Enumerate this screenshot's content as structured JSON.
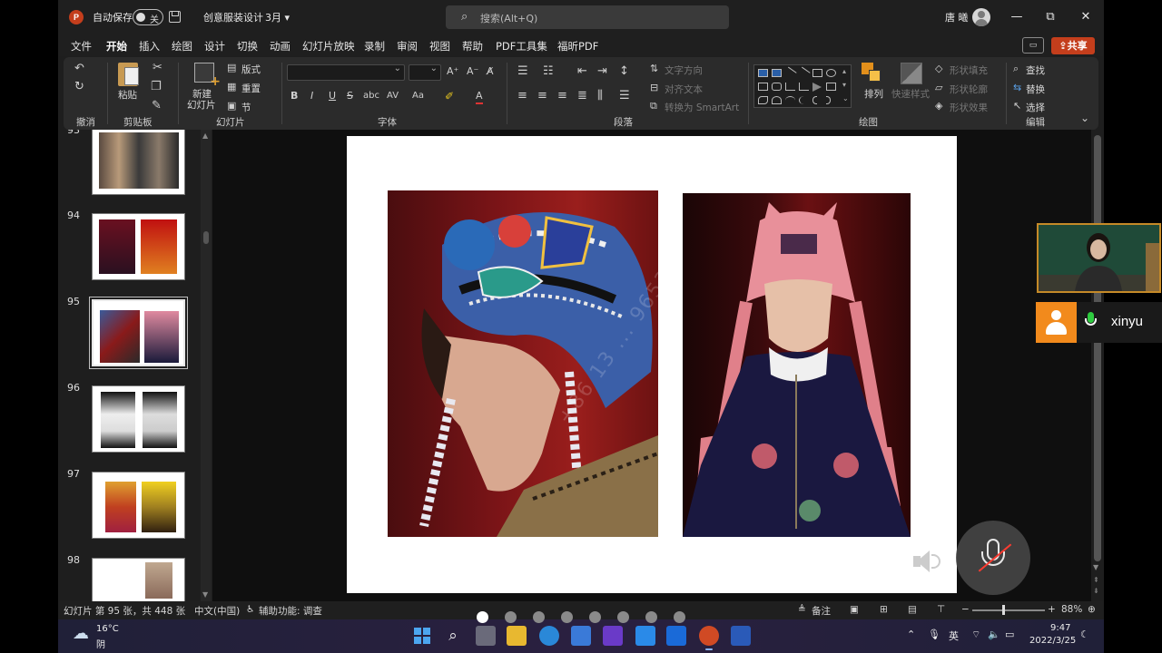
{
  "titlebar": {
    "autosave_label": "自动保存",
    "autosave_state": "关",
    "document_title": "创意服装设计",
    "title_dropdown": "3月",
    "search_placeholder": "搜索(Alt+Q)",
    "user_name": "唐 曦",
    "minimize": "—",
    "restore": "⧉",
    "close": "✕"
  },
  "tabs": [
    "文件",
    "开始",
    "插入",
    "绘图",
    "设计",
    "切换",
    "动画",
    "幻灯片放映",
    "录制",
    "审阅",
    "视图",
    "帮助",
    "PDF工具集",
    "福昕PDF"
  ],
  "active_tab": "开始",
  "share_label": "共享",
  "ribbon": {
    "groups": {
      "undo": "撤消",
      "clipboard": "剪贴板",
      "slides": "幻灯片",
      "font": "字体",
      "paragraph": "段落",
      "drawing": "绘图",
      "editing": "编辑"
    },
    "paste": "粘贴",
    "new_slide_line1": "新建",
    "new_slide_line2": "幻灯片",
    "layout": "版式",
    "reset": "重置",
    "section": "节",
    "text_direction": "文字方向",
    "align_text": "对齐文本",
    "convert_smartart": "转换为 SmartArt",
    "arrange": "排列",
    "quick_styles": "快速样式",
    "shape_fill": "形状填充",
    "shape_outline": "形状轮廓",
    "shape_effects": "形状效果",
    "find": "查找",
    "replace": "替换",
    "select": "选择"
  },
  "slides": [
    {
      "number": "93"
    },
    {
      "number": "94"
    },
    {
      "number": "95",
      "selected": true
    },
    {
      "number": "96"
    },
    {
      "number": "97"
    },
    {
      "number": "98"
    }
  ],
  "watermark": "+86 13 ... 9653",
  "meeting": {
    "participant_name": "xinyu"
  },
  "status": {
    "slide_info": "幻灯片 第 95 张，共 448 张",
    "language": "中文(中国)",
    "accessibility": "辅助功能: 调查",
    "notes": "备注",
    "zoom_minus": "−",
    "zoom_plus": "+",
    "zoom": "88%",
    "pagination_dots": 8,
    "active_dot": 0
  },
  "taskbar": {
    "weather_temp": "16°C",
    "weather_desc": "阴",
    "ime": "英",
    "time": "9:47",
    "date": "2022/3/25"
  },
  "colors": {
    "accent": "#c43e1c",
    "active_tab_underline": "#d35230",
    "video_border": "#c58a28",
    "avatar_bg": "#f28a1c"
  }
}
